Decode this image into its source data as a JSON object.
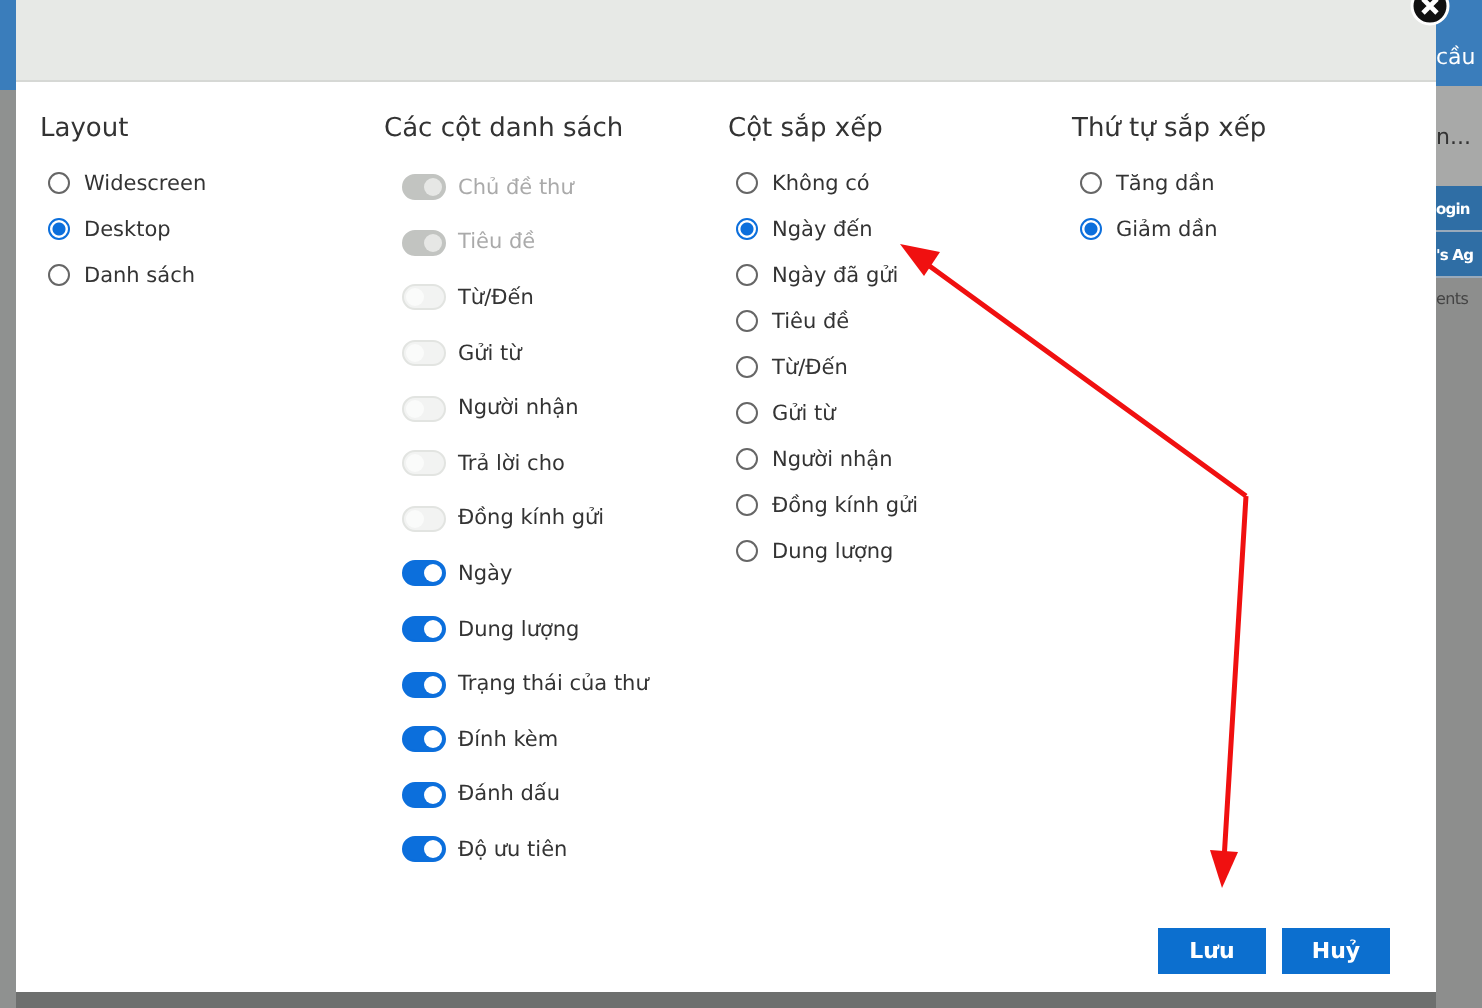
{
  "background": {
    "fragments": [
      "cầu",
      "n...",
      "ogin",
      "'s Ag",
      "ents"
    ]
  },
  "dialog": {
    "columns": [
      {
        "heading": "Layout",
        "kind": "radio",
        "items": [
          {
            "label": "Widescreen",
            "selected": false
          },
          {
            "label": "Desktop",
            "selected": true
          },
          {
            "label": "Danh sách",
            "selected": false
          }
        ]
      },
      {
        "heading": "Các cột danh sách",
        "kind": "toggle",
        "items": [
          {
            "label": "Chủ đề thư",
            "on": true,
            "disabled": true
          },
          {
            "label": "Tiêu đề",
            "on": true,
            "disabled": true
          },
          {
            "label": "Từ/Đến",
            "on": false,
            "disabled": false
          },
          {
            "label": "Gửi từ",
            "on": false,
            "disabled": false
          },
          {
            "label": "Người nhận",
            "on": false,
            "disabled": false
          },
          {
            "label": "Trả lời cho",
            "on": false,
            "disabled": false
          },
          {
            "label": "Đồng kính gửi",
            "on": false,
            "disabled": false
          },
          {
            "label": "Ngày",
            "on": true,
            "disabled": false
          },
          {
            "label": "Dung lượng",
            "on": true,
            "disabled": false
          },
          {
            "label": "Trạng thái của thư",
            "on": true,
            "disabled": false
          },
          {
            "label": "Đính kèm",
            "on": true,
            "disabled": false
          },
          {
            "label": "Đánh dấu",
            "on": true,
            "disabled": false
          },
          {
            "label": "Độ ưu tiên",
            "on": true,
            "disabled": false
          }
        ]
      },
      {
        "heading": "Cột sắp xếp",
        "kind": "radio",
        "items": [
          {
            "label": "Không có",
            "selected": false
          },
          {
            "label": "Ngày đến",
            "selected": true
          },
          {
            "label": "Ngày đã gửi",
            "selected": false
          },
          {
            "label": "Tiêu đề",
            "selected": false
          },
          {
            "label": "Từ/Đến",
            "selected": false
          },
          {
            "label": "Gửi từ",
            "selected": false
          },
          {
            "label": "Người nhận",
            "selected": false
          },
          {
            "label": "Đồng kính gửi",
            "selected": false
          },
          {
            "label": "Dung lượng",
            "selected": false
          }
        ]
      },
      {
        "heading": "Thứ tự sắp xếp",
        "kind": "radio",
        "items": [
          {
            "label": "Tăng dần",
            "selected": false
          },
          {
            "label": "Giảm dần",
            "selected": true
          }
        ]
      }
    ],
    "buttons": [
      "Lưu",
      "Huỷ"
    ]
  }
}
